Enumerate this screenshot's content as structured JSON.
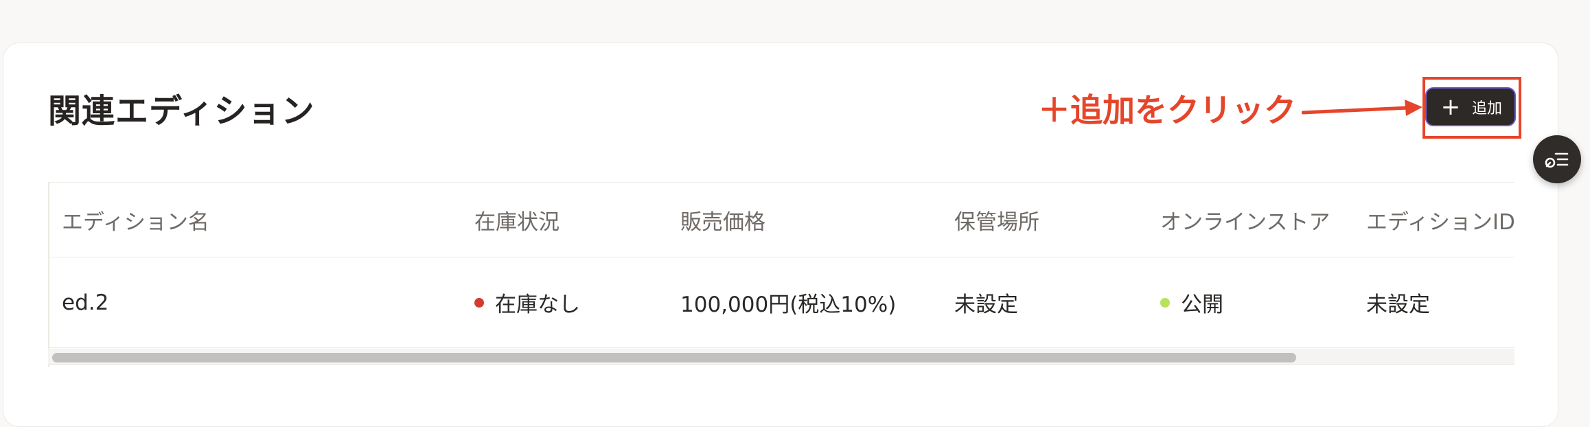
{
  "section": {
    "title": "関連エディション",
    "add_button": {
      "plus_glyph": "+",
      "label": "追加"
    }
  },
  "annotation": {
    "text": "＋追加をクリック",
    "color": "#e5452a"
  },
  "floating_button": {
    "icon": "list-icon"
  },
  "table": {
    "columns": [
      "エディション名",
      "在庫状況",
      "販売価格",
      "保管場所",
      "オンラインストア",
      "エディションID"
    ],
    "rows": [
      {
        "edition_name": "ed.2",
        "stock_status": "在庫なし",
        "stock_status_color": "#d53a2c",
        "price": "100,000円(税込10%)",
        "storage_location": "未設定",
        "online_store": "公開",
        "online_store_color": "#b8e25a",
        "edition_id": "未設定"
      }
    ]
  },
  "colors": {
    "accent": "#e5452a",
    "button_bg": "#2d2927",
    "button_border": "#6a5cd8"
  }
}
